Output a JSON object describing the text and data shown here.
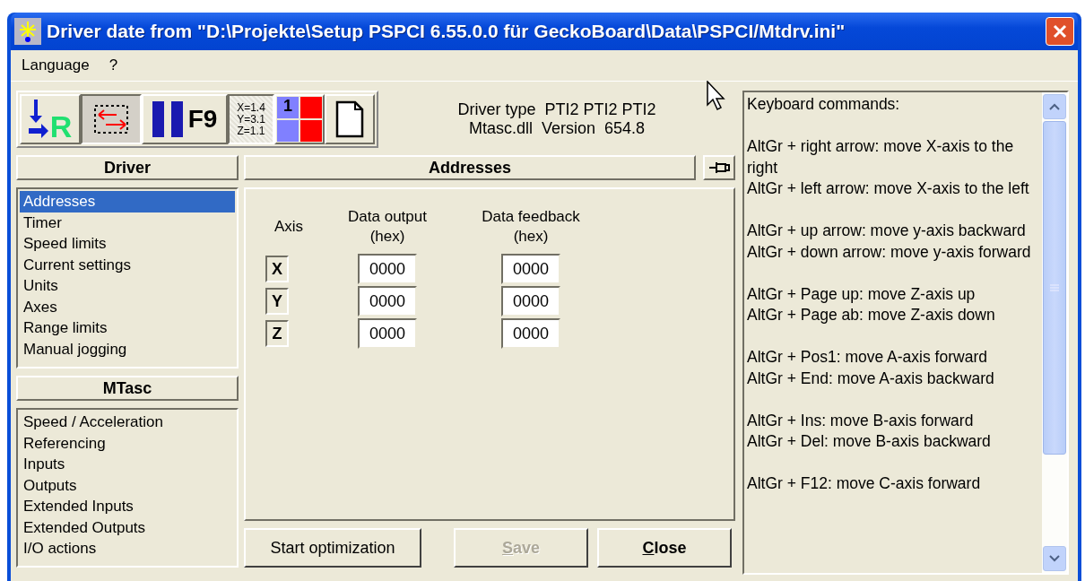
{
  "window": {
    "title": "Driver date from \"D:\\Projekte\\Setup PSPCI 6.55.0.0 für GeckoBoard\\Data\\PSPCI/Mtdrv.ini\""
  },
  "menu": [
    "Language",
    "?"
  ],
  "toolbar": [
    {
      "kind": "reference",
      "label": "R",
      "pressed": false
    },
    {
      "kind": "swap",
      "pressed": true
    },
    {
      "kind": "f9",
      "label": "F9",
      "pressed": false
    },
    {
      "kind": "coords",
      "lines": [
        "X=1.4",
        "Y=3.1",
        "Z=1.1"
      ],
      "pressed": true
    },
    {
      "kind": "grid",
      "label": "1",
      "pressed": false
    },
    {
      "kind": "page",
      "pressed": false
    }
  ],
  "driver_info": [
    "Driver type  PTI2 PTI2 PTI2",
    "Mtasc.dll  Version  654.8"
  ],
  "driver_section": {
    "title": "Driver",
    "items": [
      {
        "label": "Addresses",
        "selected": true
      },
      {
        "label": "Timer",
        "selected": false
      },
      {
        "label": "Speed limits",
        "selected": false
      },
      {
        "label": "Current settings",
        "selected": false
      },
      {
        "label": "Units",
        "selected": false
      },
      {
        "label": "Axes",
        "selected": false
      },
      {
        "label": "Range limits",
        "selected": false
      },
      {
        "label": "Manual jogging",
        "selected": false
      }
    ]
  },
  "mtasc_section": {
    "title": "MTasc",
    "items": [
      {
        "label": "Speed / Acceleration",
        "selected": false
      },
      {
        "label": "Referencing",
        "selected": false
      },
      {
        "label": "Inputs",
        "selected": false
      },
      {
        "label": "Outputs",
        "selected": false
      },
      {
        "label": "Extended Inputs",
        "selected": false
      },
      {
        "label": "Extended Outputs",
        "selected": false
      },
      {
        "label": "I/O actions",
        "selected": false
      }
    ]
  },
  "panel": {
    "title": "Addresses",
    "columns": [
      "Axis",
      "Data output\n(hex)",
      "Data feedback\n(hex)"
    ],
    "rows": [
      {
        "axis": "X",
        "output": "0000",
        "feedback": "0000"
      },
      {
        "axis": "Y",
        "output": "0000",
        "feedback": "0000"
      },
      {
        "axis": "Z",
        "output": "0000",
        "feedback": "0000"
      }
    ]
  },
  "buttons": [
    {
      "label": "Start optimization",
      "disabled": false,
      "bold": false,
      "underline_first": false
    },
    {
      "label": "Save",
      "disabled": true,
      "bold": true,
      "underline_first": true
    },
    {
      "label": "Close",
      "disabled": false,
      "bold": true,
      "underline_first": true
    }
  ],
  "keyboard_help": {
    "heading": "Keyboard commands:",
    "groups": [
      [
        "AltGr + right arrow: move X-axis to the right",
        "AltGr + left arrow:  move X-axis to the left"
      ],
      [
        "AltGr + up arrow:   move y-axis backward",
        "AltGr + down arrow: move y-axis forward"
      ],
      [
        "AltGr + Page up: move Z-axis up",
        "AltGr + Page ab: move Z-axis down"
      ],
      [
        "AltGr + Pos1: move A-axis forward",
        "AltGr + End:  move A-axis backward"
      ],
      [
        "AltGr + Ins: move B-axis forward",
        "AltGr + Del: move B-axis backward"
      ],
      [
        "AltGr + F12: move C-axis forward"
      ]
    ]
  }
}
